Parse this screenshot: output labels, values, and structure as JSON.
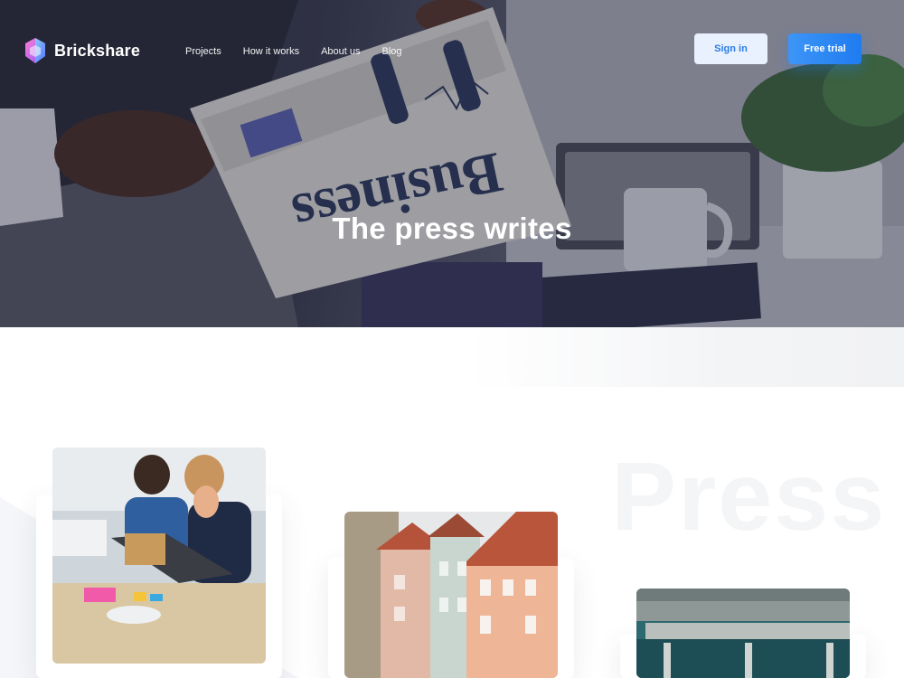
{
  "brand": {
    "name": "Brickshare"
  },
  "nav": {
    "links": [
      "Projects",
      "How it works",
      "About us",
      "Blog"
    ],
    "sign_in": "Sign in",
    "free_trial": "Free trial"
  },
  "hero": {
    "title": "The press writes"
  },
  "section": {
    "background_word": "Press"
  },
  "colors": {
    "accent": "#1f7cf0",
    "accent_light": "#e8f1fd",
    "hero_overlay": "#1e2034"
  },
  "icons": [
    "brickshare-logo-icon"
  ]
}
